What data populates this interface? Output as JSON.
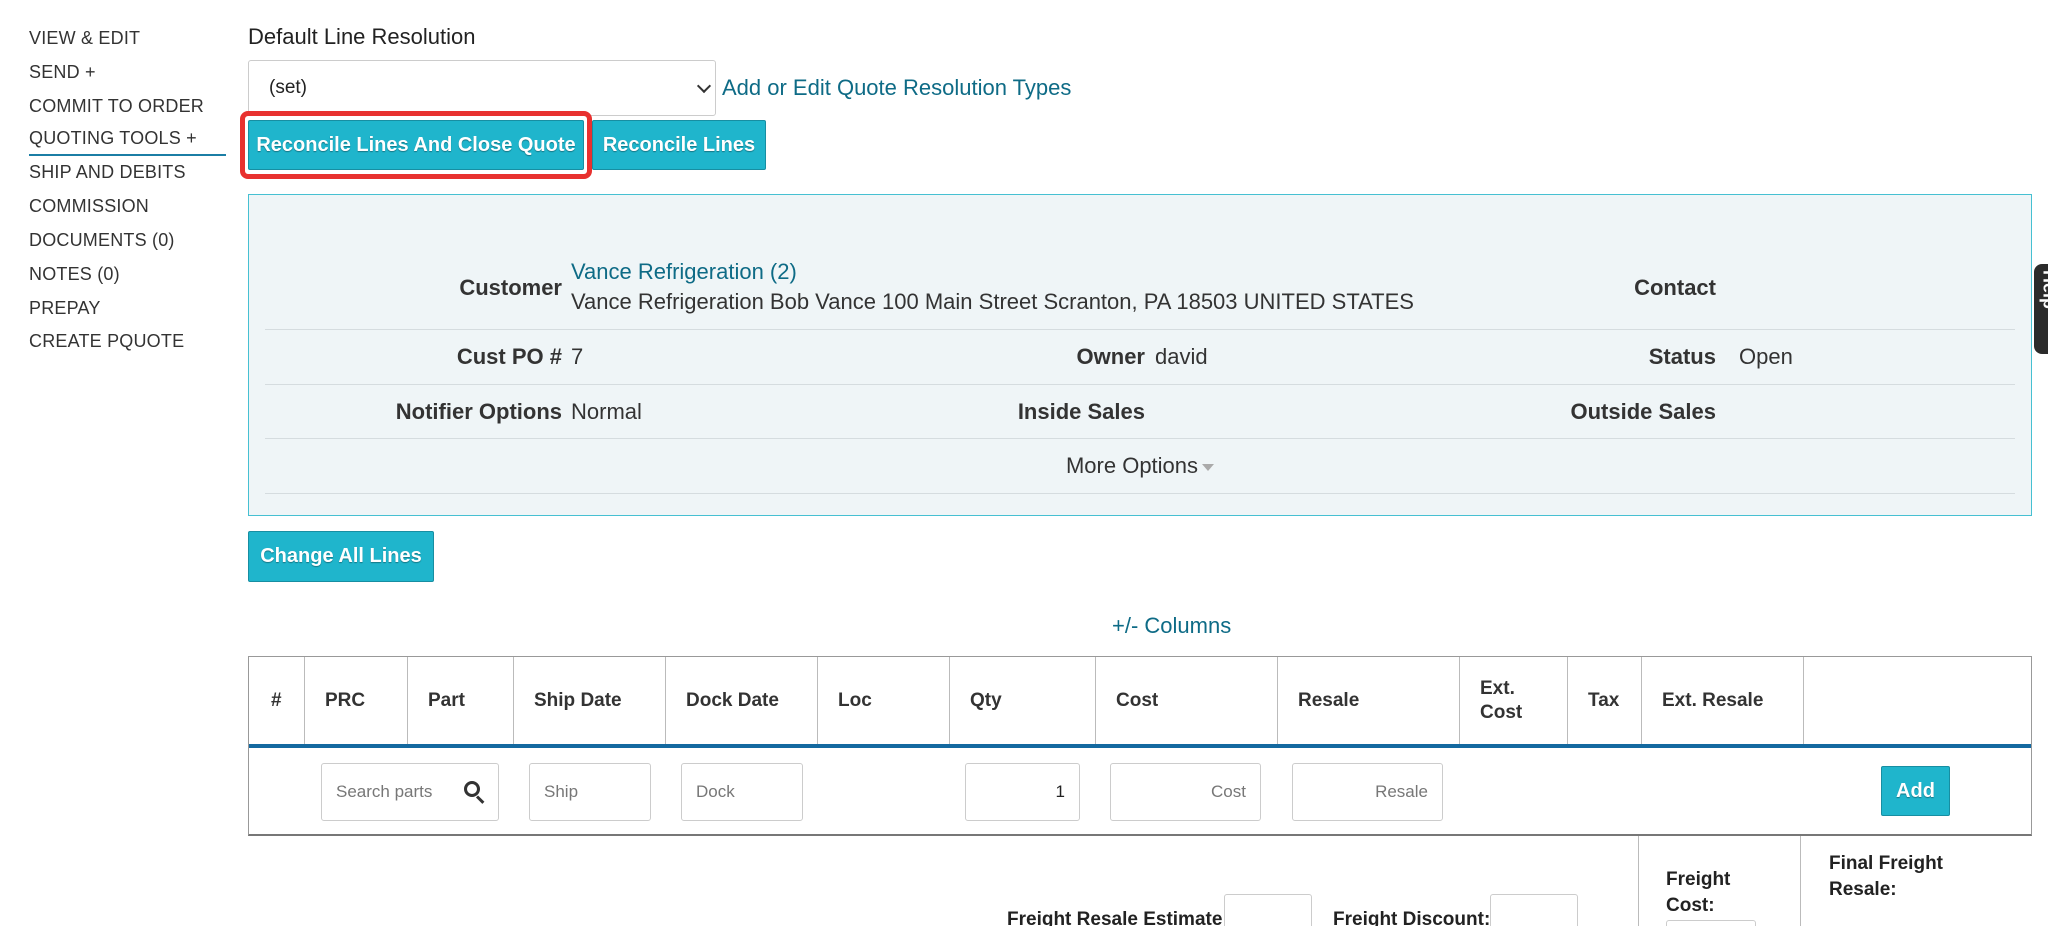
{
  "sidebar": {
    "items": [
      {
        "label": "VIEW & EDIT"
      },
      {
        "label": "SEND +"
      },
      {
        "label": "COMMIT TO ORDER"
      },
      {
        "label": "QUOTING TOOLS +"
      },
      {
        "label": "SHIP AND DEBITS"
      },
      {
        "label": "COMMISSION"
      },
      {
        "label": "DOCUMENTS (0)"
      },
      {
        "label": "NOTES (0)"
      },
      {
        "label": "PREPAY"
      },
      {
        "label": "CREATE PQUOTE"
      }
    ]
  },
  "resolution": {
    "label": "Default Line Resolution",
    "selected": "(set)",
    "edit_link": "Add or Edit Quote Resolution Types",
    "reconcile_close_label": "Reconcile Lines And Close Quote",
    "reconcile_label": "Reconcile Lines"
  },
  "info": {
    "customer_label": "Customer",
    "customer_name": "Vance Refrigeration (2)",
    "customer_address": "Vance Refrigeration Bob Vance 100 Main Street Scranton, PA 18503 UNITED STATES",
    "contact_label": "Contact",
    "cust_po_label": "Cust PO #",
    "cust_po_value": "7",
    "owner_label": "Owner",
    "owner_value": "david",
    "status_label": "Status",
    "status_value": "Open",
    "notifier_label": "Notifier Options",
    "notifier_value": "Normal",
    "inside_sales_label": "Inside Sales",
    "outside_sales_label": "Outside Sales",
    "more_options_label": "More Options"
  },
  "change_all_label": "Change All Lines",
  "columns_link": "+/- Columns",
  "table": {
    "headers": {
      "num": "#",
      "prc": "PRC",
      "part": "Part",
      "ship_date": "Ship Date",
      "dock_date": "Dock Date",
      "loc": "Loc",
      "qty": "Qty",
      "cost": "Cost",
      "resale": "Resale",
      "ext_cost_1": "Ext.",
      "ext_cost_2": "Cost",
      "tax": "Tax",
      "ext_resale": "Ext. Resale"
    },
    "inputs": {
      "search_placeholder": "Search parts",
      "ship_placeholder": "Ship",
      "dock_placeholder": "Dock",
      "qty_value": "1",
      "cost_placeholder": "Cost",
      "resale_placeholder": "Resale"
    },
    "add_label": "Add"
  },
  "freight": {
    "resale_estimate_label": "Freight Resale Estimate:",
    "discount_label": "Freight Discount:",
    "cost_label_1": "Freight",
    "cost_label_2": "Cost:",
    "final_label_1": "Final Freight",
    "final_label_2": "Resale:"
  },
  "help_tab_label": "Help",
  "colors": {
    "accent_button": "#1fb5cc",
    "link": "#0e6b86",
    "highlight": "#e8312f",
    "table_rule": "#1469a0"
  }
}
